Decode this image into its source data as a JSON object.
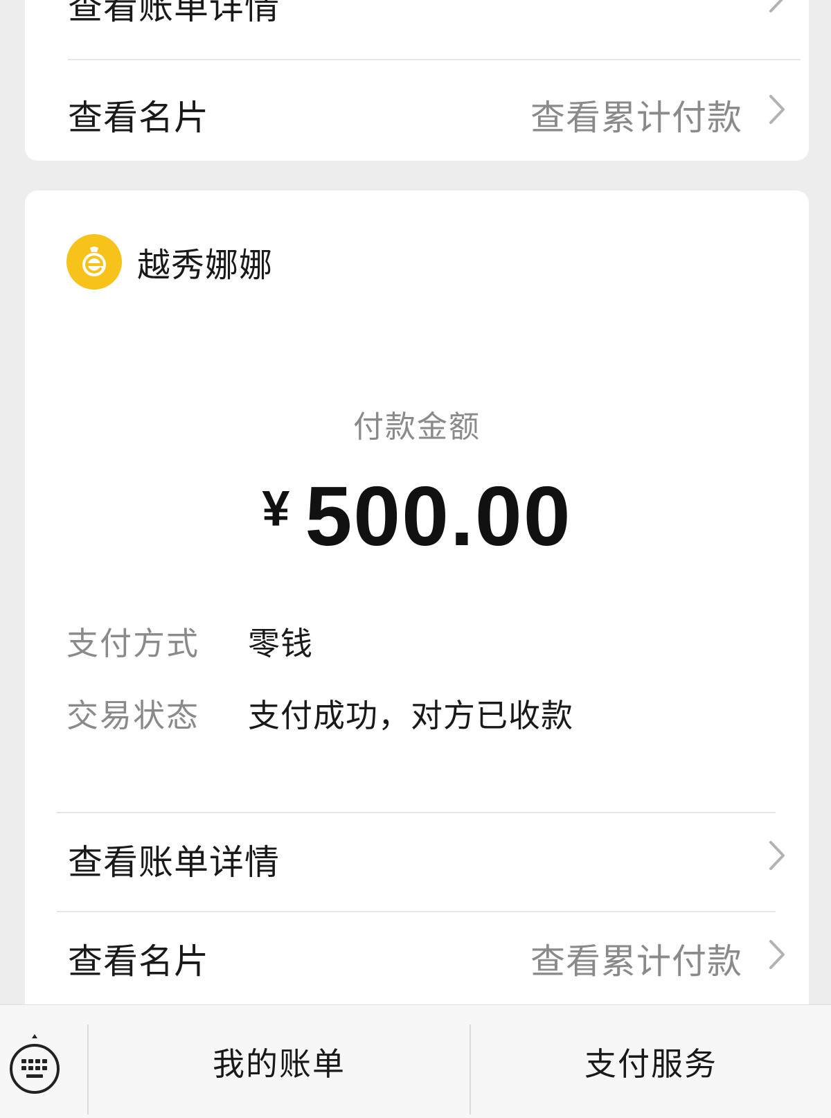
{
  "top_card": {
    "bill_detail_label": "查看账单详情",
    "card_label": "查看名片",
    "cumulative_label": "查看累计付款"
  },
  "merchant": {
    "name": "越秀娜娜",
    "logo_icon": "wechat-pay-bag-icon",
    "logo_color": "#f7c21a"
  },
  "payment": {
    "amount_label": "付款金额",
    "currency": "¥",
    "amount": "500.00"
  },
  "details": [
    {
      "key": "支付方式",
      "value": "零钱"
    },
    {
      "key": "交易状态",
      "value": "支付成功，对方已收款"
    }
  ],
  "links": {
    "bill_detail_label": "查看账单详情",
    "card_label": "查看名片",
    "cumulative_label": "查看累计付款"
  },
  "bottom_bar": {
    "keyboard_icon": "keyboard-icon",
    "my_bills_label": "我的账单",
    "pay_service_label": "支付服务"
  }
}
